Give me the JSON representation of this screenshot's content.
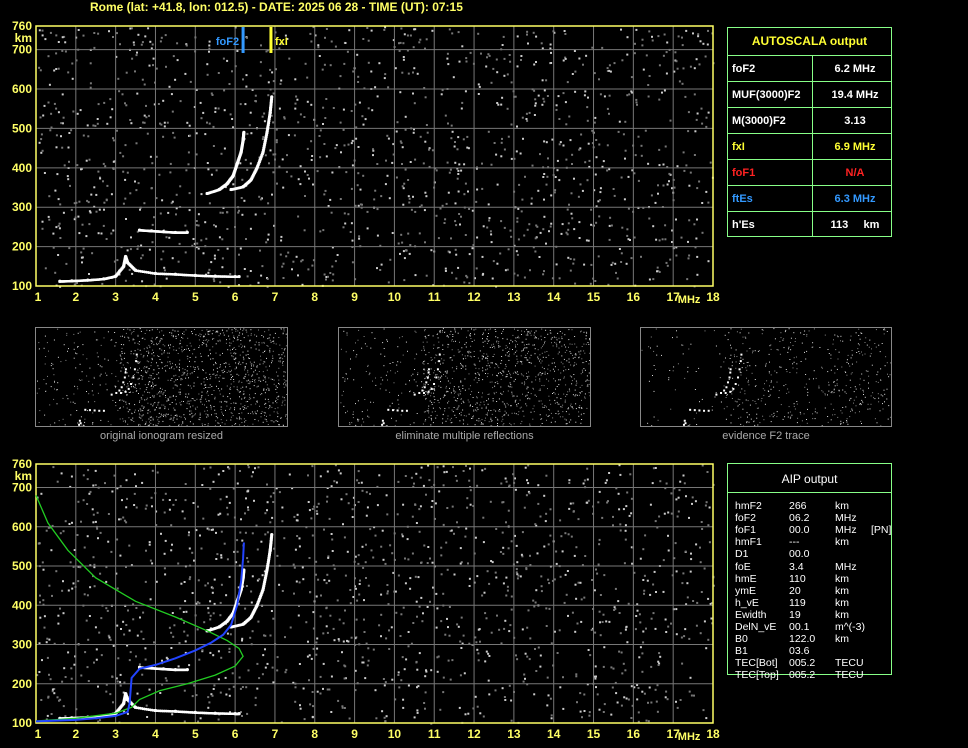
{
  "header": {
    "title": "Rome (lat: +41.8, lon: 012.5) - DATE: 2025 06 28 - TIME (UT): 07:15"
  },
  "axes": {
    "y_unit": "km",
    "x_unit": "MHz",
    "y_ticks": [
      "760",
      "700",
      "600",
      "500",
      "400",
      "300",
      "200",
      "100"
    ],
    "x_ticks": [
      "1",
      "2",
      "3",
      "4",
      "5",
      "6",
      "7",
      "8",
      "9",
      "10",
      "11",
      "12",
      "13",
      "14",
      "15",
      "16",
      "17",
      "18"
    ]
  },
  "markers": {
    "foF2_label": "foF2",
    "fxI_label": "fxI"
  },
  "autoscala": {
    "title": "AUTOSCALA output",
    "rows": [
      {
        "label": "foF2",
        "value": "6.2 MHz",
        "color": "#ffffff"
      },
      {
        "label": "MUF(3000)F2",
        "value": "19.4 MHz",
        "color": "#ffffff"
      },
      {
        "label": "M(3000)F2",
        "value": "3.13",
        "color": "#ffffff"
      },
      {
        "label": "fxI",
        "value": "6.9 MHz",
        "color": "#ffff33"
      },
      {
        "label": "foF1",
        "value": "N/A",
        "color": "#ff2222"
      },
      {
        "label": "ftEs",
        "value": "6.3 MHz",
        "color": "#3399ff"
      },
      {
        "label": "h'Es",
        "value": "113     km",
        "color": "#ffffff"
      }
    ]
  },
  "thumbnails": [
    {
      "caption": "original ionogram resized"
    },
    {
      "caption": "eliminate multiple reflections"
    },
    {
      "caption": "evidence F2 trace"
    }
  ],
  "aip": {
    "title": "AIP output",
    "rows": [
      {
        "name": "hmF2",
        "value": "266",
        "unit": "km",
        "extra": ""
      },
      {
        "name": "foF2",
        "value": "06.2",
        "unit": "MHz",
        "extra": ""
      },
      {
        "name": "foF1",
        "value": "00.0",
        "unit": "MHz",
        "extra": "[PN]"
      },
      {
        "name": "hmF1",
        "value": "---",
        "unit": "km",
        "extra": ""
      },
      {
        "name": "D1",
        "value": "00.0",
        "unit": "",
        "extra": ""
      },
      {
        "name": "foE",
        "value": "3.4",
        "unit": "MHz",
        "extra": ""
      },
      {
        "name": "hmE",
        "value": "110",
        "unit": "km",
        "extra": ""
      },
      {
        "name": "ymE",
        "value": "20",
        "unit": "km",
        "extra": ""
      },
      {
        "name": "h_vE",
        "value": "119",
        "unit": "km",
        "extra": ""
      },
      {
        "name": "Ewidth",
        "value": "19",
        "unit": "km",
        "extra": ""
      },
      {
        "name": "DelN_vE",
        "value": "00.1",
        "unit": "m^(-3)",
        "extra": ""
      },
      {
        "name": "B0",
        "value": "122.0",
        "unit": "km",
        "extra": ""
      },
      {
        "name": "B1",
        "value": "03.6",
        "unit": "",
        "extra": ""
      },
      {
        "name": "TEC[Bot]",
        "value": "005.2",
        "unit": "TECU",
        "extra": ""
      },
      {
        "name": "TEC[Top]",
        "value": "005.2",
        "unit": "TECU",
        "extra": ""
      }
    ]
  },
  "chart_data": [
    {
      "type": "scatter",
      "title": "",
      "xlabel": "MHz",
      "ylabel": "km",
      "xlim": [
        1,
        18
      ],
      "ylim": [
        100,
        760
      ],
      "grid": true,
      "markers": [
        {
          "name": "foF2",
          "x": 6.2,
          "color": "#3399ff"
        },
        {
          "name": "fxI",
          "x": 6.9,
          "color": "#ffff33"
        }
      ],
      "series": [
        {
          "points": [
            [
              1.6,
              112
            ],
            [
              1.9,
              113
            ],
            [
              2.3,
              115
            ],
            [
              2.7,
              118
            ],
            [
              3.0,
              125
            ],
            [
              3.2,
              150
            ],
            [
              3.25,
              175
            ],
            [
              3.3,
              160
            ],
            [
              3.5,
              140
            ],
            [
              4.0,
              132
            ],
            [
              4.5,
              130
            ],
            [
              5.0,
              127
            ],
            [
              5.5,
              125
            ],
            [
              6.0,
              124
            ],
            [
              6.1,
              124
            ]
          ]
        },
        {
          "points": [
            [
              3.6,
              242
            ],
            [
              3.9,
              240
            ],
            [
              4.2,
              238
            ],
            [
              4.5,
              236
            ],
            [
              4.8,
              236
            ]
          ]
        },
        {
          "points": [
            [
              5.3,
              335
            ],
            [
              5.6,
              345
            ],
            [
              5.8,
              360
            ],
            [
              5.95,
              380
            ],
            [
              6.05,
              410
            ],
            [
              6.15,
              440
            ],
            [
              6.2,
              470
            ],
            [
              6.22,
              490
            ]
          ]
        },
        {
          "points": [
            [
              5.9,
              345
            ],
            [
              6.2,
              352
            ],
            [
              6.4,
              370
            ],
            [
              6.55,
              400
            ],
            [
              6.7,
              440
            ],
            [
              6.8,
              490
            ],
            [
              6.88,
              540
            ],
            [
              6.92,
              580
            ]
          ]
        }
      ]
    },
    {
      "type": "scatter",
      "title": "",
      "xlabel": "MHz",
      "ylabel": "km",
      "xlim": [
        1,
        18
      ],
      "ylim": [
        100,
        760
      ],
      "grid": true,
      "series": [
        {
          "points": [
            [
              1.6,
              112
            ],
            [
              1.9,
              113
            ],
            [
              2.3,
              115
            ],
            [
              2.7,
              118
            ],
            [
              3.0,
              125
            ],
            [
              3.2,
              150
            ],
            [
              3.25,
              175
            ],
            [
              3.3,
              160
            ],
            [
              3.5,
              140
            ],
            [
              4.0,
              132
            ],
            [
              4.5,
              130
            ],
            [
              5.0,
              127
            ],
            [
              5.5,
              125
            ],
            [
              6.0,
              124
            ],
            [
              6.1,
              124
            ]
          ]
        },
        {
          "points": [
            [
              3.6,
              242
            ],
            [
              3.9,
              240
            ],
            [
              4.2,
              238
            ],
            [
              4.5,
              236
            ],
            [
              4.8,
              236
            ]
          ]
        },
        {
          "points": [
            [
              5.3,
              335
            ],
            [
              5.6,
              345
            ],
            [
              5.8,
              360
            ],
            [
              5.95,
              380
            ],
            [
              6.05,
              410
            ],
            [
              6.15,
              440
            ],
            [
              6.2,
              470
            ],
            [
              6.22,
              490
            ]
          ]
        },
        {
          "points": [
            [
              5.9,
              345
            ],
            [
              6.2,
              352
            ],
            [
              6.4,
              370
            ],
            [
              6.55,
              400
            ],
            [
              6.7,
              440
            ],
            [
              6.8,
              490
            ],
            [
              6.88,
              540
            ],
            [
              6.92,
              580
            ]
          ]
        }
      ],
      "lines": [
        {
          "color": "#22cc22",
          "points": [
            [
              1.0,
              680
            ],
            [
              1.3,
              610
            ],
            [
              1.8,
              540
            ],
            [
              2.5,
              470
            ],
            [
              3.5,
              410
            ],
            [
              4.5,
              370
            ],
            [
              5.3,
              335
            ],
            [
              5.8,
              310
            ],
            [
              6.1,
              290
            ],
            [
              6.2,
              270
            ],
            [
              6.0,
              245
            ],
            [
              5.5,
              222
            ],
            [
              4.8,
              200
            ],
            [
              4.1,
              182
            ],
            [
              3.6,
              160
            ],
            [
              3.4,
              140
            ],
            [
              3.0,
              125
            ],
            [
              2.0,
              112
            ],
            [
              1.0,
              105
            ]
          ]
        },
        {
          "color": "#2244ff",
          "points": [
            [
              1.0,
              104
            ],
            [
              1.5,
              106
            ],
            [
              2.0,
              108
            ],
            [
              2.5,
              112
            ],
            [
              3.0,
              118
            ],
            [
              3.3,
              128
            ],
            [
              3.35,
              150
            ],
            [
              3.4,
              215
            ],
            [
              3.6,
              238
            ],
            [
              4.0,
              248
            ],
            [
              4.5,
              265
            ],
            [
              5.0,
              285
            ],
            [
              5.4,
              305
            ],
            [
              5.7,
              325
            ],
            [
              5.9,
              350
            ],
            [
              6.05,
              400
            ],
            [
              6.15,
              460
            ],
            [
              6.2,
              520
            ],
            [
              6.22,
              560
            ]
          ]
        }
      ]
    }
  ]
}
